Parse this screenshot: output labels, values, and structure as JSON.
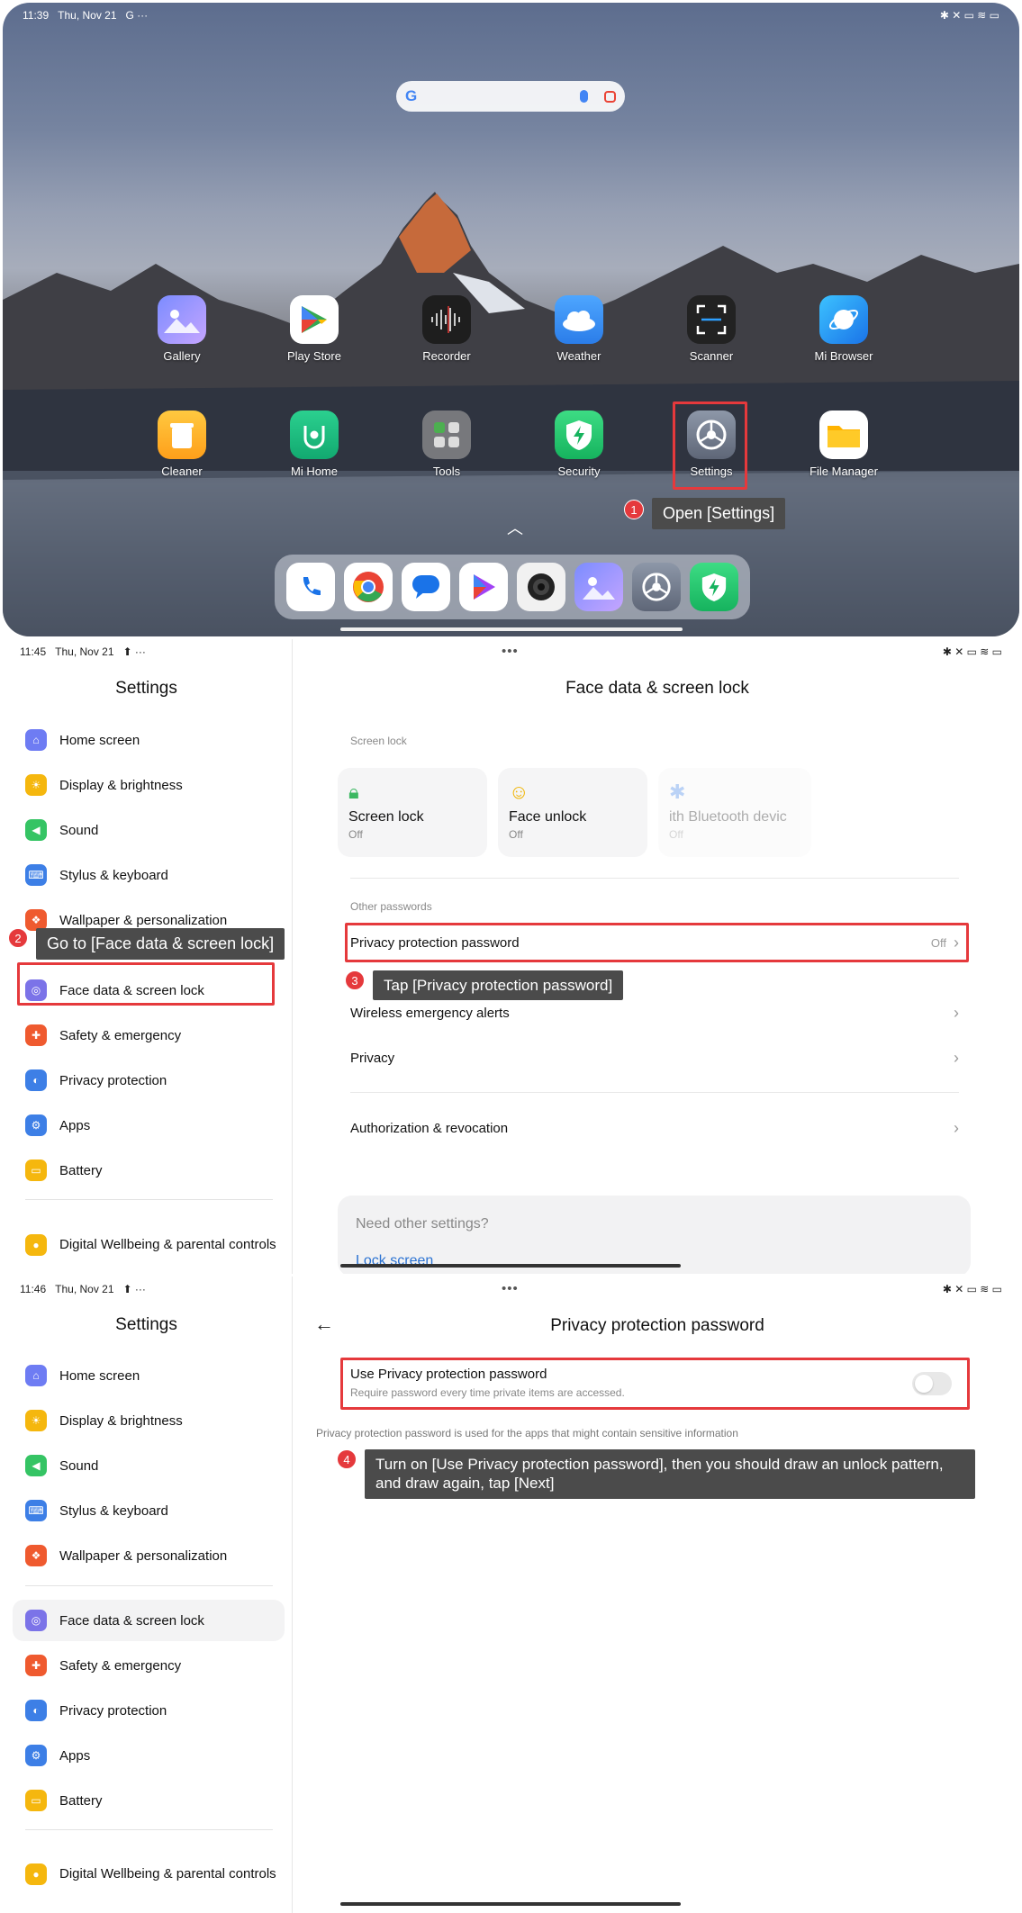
{
  "home": {
    "status": {
      "time": "11:39",
      "date": "Thu, Nov 21",
      "extra": "G  ···",
      "right_icons": "✱ ✕ ▭ ≋ ▭"
    },
    "apps_row1": [
      {
        "label": "Gallery",
        "icon": "gallery-icon"
      },
      {
        "label": "Play Store",
        "icon": "play-store-icon"
      },
      {
        "label": "Recorder",
        "icon": "recorder-icon"
      },
      {
        "label": "Weather",
        "icon": "weather-icon"
      },
      {
        "label": "Scanner",
        "icon": "scanner-icon"
      },
      {
        "label": "Mi Browser",
        "icon": "browser-icon"
      }
    ],
    "apps_row2": [
      {
        "label": "Cleaner",
        "icon": "cleaner-icon"
      },
      {
        "label": "Mi Home",
        "icon": "mi-home-icon"
      },
      {
        "label": "Tools",
        "icon": "tools-icon"
      },
      {
        "label": "Security",
        "icon": "security-icon"
      },
      {
        "label": "Settings",
        "icon": "settings-icon"
      },
      {
        "label": "File Manager",
        "icon": "file-manager-icon"
      }
    ],
    "dock": [
      "phone-icon",
      "chrome-icon",
      "messages-icon",
      "play-games-icon",
      "camera-icon",
      "gallery-icon",
      "settings-icon",
      "security-icon"
    ],
    "step1": {
      "num": "1",
      "text": "Open [Settings]"
    }
  },
  "panel2": {
    "status": {
      "time": "11:45",
      "date": "Thu, Nov 21",
      "extra": "⬆  ···",
      "right_icons": "✱ ✕ ▭ ≋ ▭"
    },
    "sidebar_title": "Settings",
    "sidebar_items": [
      "Home screen",
      "Display & brightness",
      "Sound",
      "Stylus & keyboard",
      "Wallpaper & personalization",
      "Face data & screen lock",
      "Safety & emergency",
      "Privacy protection",
      "Apps",
      "Battery"
    ],
    "sidebar_last": "Digital Wellbeing & parental controls",
    "title": "Face data & screen lock",
    "screen_lock_label": "Screen lock",
    "cards": [
      {
        "title": "Screen lock",
        "sub": "Off"
      },
      {
        "title": "Face unlock",
        "sub": "Off"
      },
      {
        "title": "ith Bluetooth devic",
        "sub": "Off"
      }
    ],
    "other_passwords_label": "Other passwords",
    "rows": {
      "privacy_password": "Privacy protection password",
      "privacy_password_value": "Off",
      "wireless_alerts": "Wireless emergency alerts",
      "privacy": "Privacy",
      "authorization": "Authorization & revocation"
    },
    "help": {
      "question": "Need other settings?",
      "link": "Lock screen"
    },
    "step2": {
      "num": "2",
      "text": "Go to [Face data & screen lock]"
    },
    "step3": {
      "num": "3",
      "text": "Tap [Privacy protection password]"
    }
  },
  "panel3": {
    "status": {
      "time": "11:46",
      "date": "Thu, Nov 21",
      "extra": "⬆  ···",
      "right_icons": "✱ ✕ ▭ ≋ ▭"
    },
    "sidebar_title": "Settings",
    "sidebar_items": [
      "Home screen",
      "Display & brightness",
      "Sound",
      "Stylus & keyboard",
      "Wallpaper & personalization",
      "Face data & screen lock",
      "Safety & emergency",
      "Privacy protection",
      "Apps",
      "Battery"
    ],
    "sidebar_last": "Digital Wellbeing & parental controls",
    "title": "Privacy protection password",
    "toggle_title": "Use Privacy protection password",
    "toggle_sub": "Require password every time private items are accessed.",
    "note": "Privacy protection password is used for the apps that might contain sensitive information",
    "step4": {
      "num": "4",
      "text": "Turn on [Use Privacy protection password], then you should draw an unlock pattern, and draw again, tap [Next]"
    }
  },
  "colors": {
    "highlight": "#e5393c",
    "tooltip": "#4b4b4b",
    "link": "#2c73d2"
  }
}
